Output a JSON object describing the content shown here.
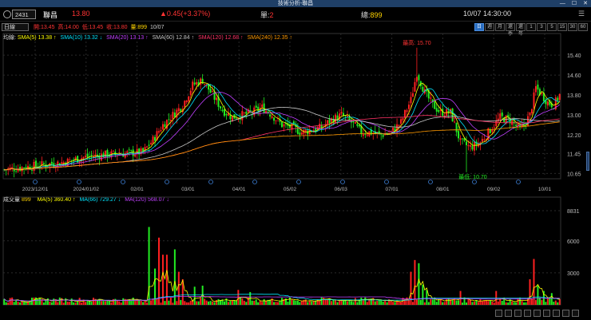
{
  "window": {
    "title": "技術分析-聯昌",
    "controls": [
      "—",
      "☐",
      "✕"
    ]
  },
  "quote": {
    "code": "2431",
    "name": "聯昌",
    "price": "13.80",
    "change": "▲0.45(+3.37%)",
    "single_label": "單:",
    "single_value": "2",
    "total_label": "總:",
    "total_value": "899",
    "datetime": "10/07 14:30:00",
    "menu_icon": "menu-icon"
  },
  "toolbar": {
    "period": "日線",
    "open": "開:13.45",
    "high": "高:14.00",
    "low": "低:13.45",
    "close": "收:13.80",
    "volume": "量:899",
    "date": "10/07",
    "interval_buttons": [
      "日",
      "週",
      "月",
      "還季",
      "還年",
      "1",
      "3",
      "5",
      "15",
      "30",
      "60"
    ],
    "active_interval": "日"
  },
  "ma_legend": {
    "label": "均線:",
    "items": [
      {
        "text": "SMA(5) 13.38 ↑",
        "color": "#ffff00"
      },
      {
        "text": "SMA(10) 13.32 ↓",
        "color": "#00e5ff"
      },
      {
        "text": "SMA(20) 13.13 ↑",
        "color": "#c040ff"
      },
      {
        "text": "SMA(60) 12.84 ↑",
        "color": "#c8c8c8"
      },
      {
        "text": "SMA(120) 12.68 ↑",
        "color": "#ff3366"
      },
      {
        "text": "SMA(240) 12.35 ↑",
        "color": "#ff9900"
      }
    ]
  },
  "vol_legend": {
    "label": "成交量",
    "value": "899",
    "items": [
      {
        "text": "MA(5) 360.40 ↑",
        "color": "#ffff00"
      },
      {
        "text": "MA(66) 729.27 ↓",
        "color": "#00e5ff"
      },
      {
        "text": "MA(120) 568.07 ↓",
        "color": "#c040ff"
      }
    ]
  },
  "colors": {
    "up": "#ff2020",
    "down": "#22ee22",
    "grid": "#2a2a2a",
    "axis_text": "#bbbbbb",
    "high_label": "#ff3333",
    "low_label": "#22ee22"
  },
  "chart_data": {
    "type": "candlestick",
    "price_axis": {
      "ticks": [
        15.4,
        14.6,
        13.8,
        13.0,
        12.2,
        11.45,
        10.65
      ],
      "ylim": [
        10.5,
        15.95
      ]
    },
    "volume_axis": {
      "ticks": [
        8831,
        6000,
        3000
      ],
      "ylim": [
        0,
        9500
      ]
    },
    "x_tick_labels": [
      "2023/12/01",
      "2024/01/02",
      "02/01",
      "03/01",
      "04/01",
      "05/02",
      "06/03",
      "07/01",
      "08/01",
      "09/02",
      "10/01"
    ],
    "annotations": {
      "high": "最高: 15.70",
      "low": "最低: 10.70"
    },
    "close_anchors": [
      [
        0,
        10.8
      ],
      [
        10,
        10.9
      ],
      [
        20,
        11.0
      ],
      [
        30,
        11.1
      ],
      [
        40,
        11.3
      ],
      [
        50,
        11.4
      ],
      [
        60,
        11.45
      ],
      [
        70,
        11.5
      ],
      [
        75,
        12.0
      ],
      [
        80,
        12.6
      ],
      [
        90,
        13.4
      ],
      [
        95,
        14.2
      ],
      [
        100,
        14.4
      ],
      [
        105,
        13.8
      ],
      [
        110,
        13.2
      ],
      [
        115,
        12.9
      ],
      [
        120,
        13.0
      ],
      [
        125,
        13.1
      ],
      [
        130,
        13.3
      ],
      [
        135,
        13.0
      ],
      [
        140,
        12.6
      ],
      [
        145,
        12.5
      ],
      [
        150,
        12.3
      ],
      [
        155,
        12.4
      ],
      [
        160,
        12.5
      ],
      [
        165,
        12.8
      ],
      [
        170,
        13.0
      ],
      [
        175,
        12.7
      ],
      [
        180,
        12.3
      ],
      [
        185,
        12.3
      ],
      [
        190,
        12.2
      ],
      [
        195,
        12.3
      ],
      [
        200,
        12.7
      ],
      [
        205,
        13.6
      ],
      [
        208,
        14.7
      ],
      [
        212,
        13.9
      ],
      [
        216,
        13.4
      ],
      [
        220,
        13.1
      ],
      [
        225,
        13.1
      ],
      [
        230,
        11.9
      ],
      [
        235,
        11.7
      ],
      [
        240,
        11.9
      ],
      [
        245,
        12.4
      ],
      [
        250,
        12.9
      ],
      [
        255,
        12.8
      ],
      [
        260,
        12.4
      ],
      [
        262,
        12.6
      ],
      [
        265,
        13.0
      ],
      [
        268,
        14.1
      ],
      [
        271,
        13.8
      ],
      [
        274,
        13.5
      ],
      [
        277,
        13.4
      ],
      [
        280,
        13.8
      ]
    ],
    "volume_spikes": [
      [
        73,
        7300
      ],
      [
        76,
        3400
      ],
      [
        78,
        6300
      ],
      [
        80,
        4700
      ],
      [
        82,
        4700
      ],
      [
        86,
        5200
      ],
      [
        88,
        3100
      ],
      [
        90,
        2400
      ],
      [
        96,
        1700
      ],
      [
        100,
        1800
      ],
      [
        118,
        1400
      ],
      [
        124,
        1200
      ],
      [
        205,
        3100
      ],
      [
        207,
        4200
      ],
      [
        209,
        3900
      ],
      [
        211,
        1900
      ],
      [
        213,
        1400
      ],
      [
        230,
        1300
      ],
      [
        248,
        1300
      ],
      [
        265,
        2400
      ],
      [
        267,
        4300
      ],
      [
        269,
        1800
      ],
      [
        272,
        1300
      ],
      [
        276,
        1100
      ]
    ],
    "count": 281
  }
}
